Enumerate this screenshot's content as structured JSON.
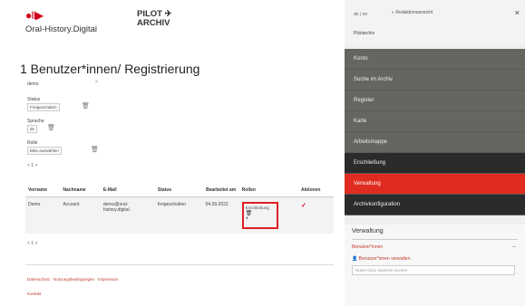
{
  "header": {
    "logo_marks": "●II▶",
    "logo_text": "Oral-History.Digital",
    "pilot_line1": "PILOT ✈",
    "pilot_line2": "ARCHIV"
  },
  "page": {
    "title": "1 Benutzer*innen/ Registrierung",
    "filter_name": "demo",
    "status_label": "Status",
    "status_value": "Freigeschalten",
    "sprache_label": "Sprache",
    "sprache_value": "de",
    "rolle_label": "Rolle",
    "rolle_value": "Bitte auswählen",
    "pager_top": "< 1 >",
    "pager_bottom": "< 1 >"
  },
  "table": {
    "headers": [
      "Vorname",
      "Nachname",
      "E-Mail",
      "Status",
      "Bearbeitet am",
      "Rollen",
      "Aktionen"
    ],
    "row": {
      "vorname": "Demo",
      "nachname": "Account",
      "email": "demo@oral-history.digital",
      "status": "freigeschalten",
      "bearbeitet": "04.09.2022",
      "rollen": "Erschließung",
      "aktion": "✓"
    }
  },
  "footer": {
    "links": "Datenschutz · Nutzungsbedingungen · Impressum",
    "links2": "Kontakt"
  },
  "sidebar": {
    "lang": "de | en",
    "toggle_label": "Redaktionsansicht",
    "subtitle": "Pilotarchiv",
    "close": "×",
    "menu": [
      {
        "label": "Konto",
        "style": "normal"
      },
      {
        "label": "Suche im Archiv",
        "style": "normal"
      },
      {
        "label": "Register",
        "style": "normal"
      },
      {
        "label": "Karte",
        "style": "normal"
      },
      {
        "label": "Arbeitsmappe",
        "style": "normal"
      },
      {
        "label": "Erschließung",
        "style": "dark"
      },
      {
        "label": "Verwaltung",
        "style": "active"
      },
      {
        "label": "Archivkonfiguration",
        "style": "dark"
      }
    ],
    "section_title": "Verwaltung",
    "section_item1": "Benutzer*innen",
    "section_item2": "Benutzer*innen verwalten",
    "search_placeholder": "Nutzer bzw. Nutzerin suchen"
  }
}
